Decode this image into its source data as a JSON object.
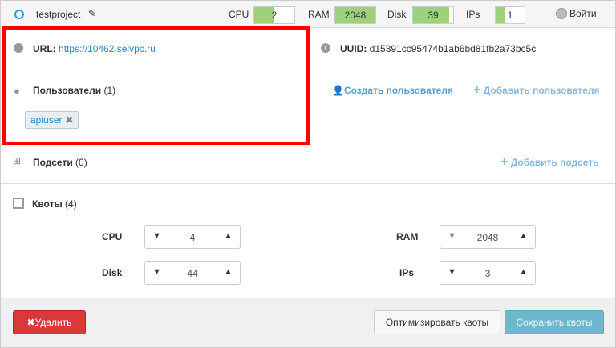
{
  "header": {
    "project_name": "testproject",
    "meters": [
      {
        "label": "CPU",
        "value": "2",
        "fill": 0.5
      },
      {
        "label": "RAM",
        "value": "2048",
        "fill": 1.0
      },
      {
        "label": "Disk",
        "value": "39",
        "fill": 0.9
      },
      {
        "label": "IPs",
        "value": "1",
        "fill": 0.33
      }
    ],
    "login_label": "Войти"
  },
  "info": {
    "url_label": "URL:",
    "url": "https://10462.selvpc.ru",
    "uuid_label": "UUID:",
    "uuid": "d15391cc95474b1ab6bd81fb2a73bc5c"
  },
  "users": {
    "title": "Пользователи",
    "count": "(1)",
    "create_label": "Создать пользователя",
    "add_label": "Добавить пользователя",
    "tags": [
      "apiuser"
    ]
  },
  "subnets": {
    "title": "Подсети",
    "count": "(0)",
    "add_label": "Добавить подсеть"
  },
  "quotas": {
    "title": "Квоты",
    "count": "(4)",
    "items": [
      {
        "label": "CPU",
        "value": "4"
      },
      {
        "label": "RAM",
        "value": "2048"
      },
      {
        "label": "Disk",
        "value": "44"
      },
      {
        "label": "IPs",
        "value": "3"
      }
    ]
  },
  "footer": {
    "delete_label": "Удалить",
    "optimize_label": "Оптимизировать квоты",
    "save_label": "Сохранить квоты"
  }
}
